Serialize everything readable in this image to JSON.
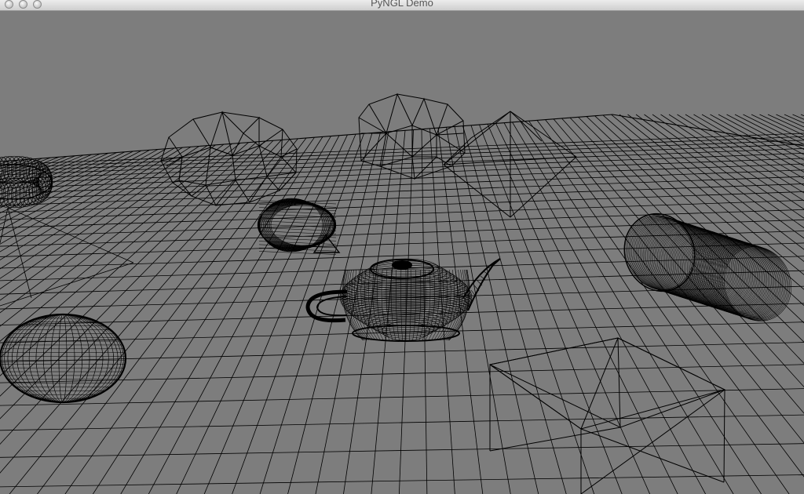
{
  "window": {
    "title": "PyNGL Demo",
    "buttons": [
      "close",
      "minimize",
      "zoom"
    ]
  },
  "scene": {
    "background_color": "#7d7d7d",
    "wire_color": "#000000",
    "render_mode": "wireframe",
    "objects": [
      "grid-plane",
      "torus",
      "geosphere",
      "cone",
      "icosahedron",
      "pyramid",
      "teapot",
      "cylinder",
      "sphere",
      "cube"
    ]
  }
}
